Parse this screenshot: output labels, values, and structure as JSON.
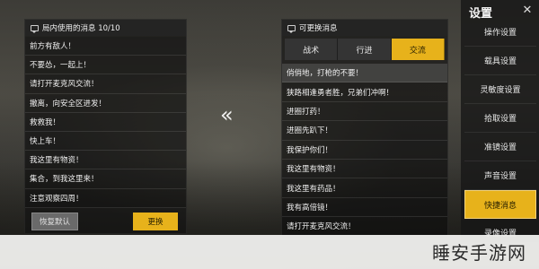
{
  "left_panel": {
    "title": "局内使用的消息 10/10",
    "messages": [
      "前方有敌人！",
      "不要怂，一起上！",
      "请打开麦克风交流！",
      "撤离，向安全区进发！",
      "救救我！",
      "快上车！",
      "我这里有物资！",
      "集合，到我这里来！",
      "注意观察四周！"
    ],
    "restore_label": "恢复默认",
    "replace_label": "更换"
  },
  "swap_arrow": "«",
  "right_panel": {
    "title": "可更换消息",
    "tabs": [
      "战术",
      "行进",
      "交流"
    ],
    "active_tab": "交流",
    "messages": [
      "俏俏地，打枪的不要！",
      "狭路相逢勇者胜，兄弟们冲啊！",
      "进圈打药！",
      "进圈先趴下！",
      "我保护你们！",
      "我这里有物资！",
      "我这里有药品！",
      "我有高倍镜！",
      "请打开麦克风交流！"
    ]
  },
  "settings": {
    "title": "设置",
    "close_icon": "close-icon",
    "items": [
      "操作设置",
      "载具设置",
      "灵敏度设置",
      "拾取设置",
      "准镜设置",
      "声音设置",
      "快捷消息",
      "录像设置"
    ],
    "active_item": "快捷消息"
  },
  "watermark": "睡安手游网",
  "colors": {
    "accent": "#e7b21b",
    "panel_bg": "#101010"
  }
}
